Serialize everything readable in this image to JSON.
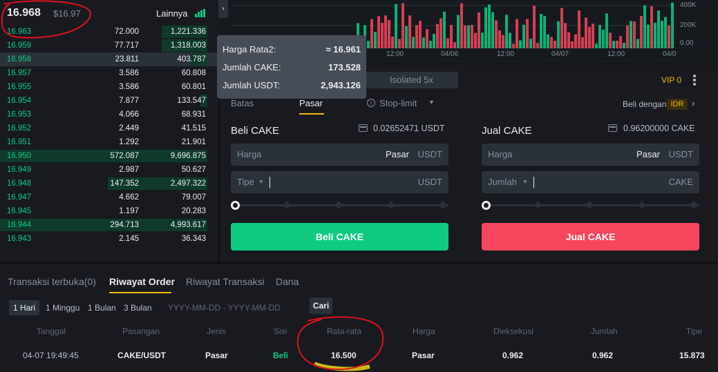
{
  "orderbook": {
    "last_price": "16.968",
    "last_price_usd": "$16.97",
    "more_label": "Lainnya",
    "rows": [
      {
        "price": "16.963",
        "amount": "72.000",
        "total": "1,221.336"
      },
      {
        "price": "16.959",
        "amount": "77.717",
        "total": "1,318.003"
      },
      {
        "price": "16.958",
        "amount": "23.811",
        "total": "403.787"
      },
      {
        "price": "16.957",
        "amount": "3.586",
        "total": "60.808"
      },
      {
        "price": "16.955",
        "amount": "3.586",
        "total": "60.801"
      },
      {
        "price": "16.954",
        "amount": "7.877",
        "total": "133.547"
      },
      {
        "price": "16.953",
        "amount": "4.066",
        "total": "68.931"
      },
      {
        "price": "16.952",
        "amount": "2.449",
        "total": "41.515"
      },
      {
        "price": "16.951",
        "amount": "1.292",
        "total": "21.901"
      },
      {
        "price": "16.950",
        "amount": "572.087",
        "total": "9,696.875"
      },
      {
        "price": "16.949",
        "amount": "2.987",
        "total": "50.627"
      },
      {
        "price": "16.948",
        "amount": "147.352",
        "total": "2,497.322"
      },
      {
        "price": "16.947",
        "amount": "4.662",
        "total": "79.007"
      },
      {
        "price": "16.945",
        "amount": "1.197",
        "total": "20.283"
      },
      {
        "price": "16.944",
        "amount": "294.713",
        "total": "4,993.617"
      },
      {
        "price": "16.943",
        "amount": "2.145",
        "total": "36.343"
      }
    ]
  },
  "chart": {
    "collapse_glyph": "›",
    "time_labels": [
      "12:00",
      "04/06",
      "12:00",
      "04/07",
      "12:00",
      "04/0"
    ],
    "volume_labels": [
      "400K",
      "200K",
      "0.00"
    ]
  },
  "tooltip": {
    "avg_price_label": "Harga Rata2:",
    "avg_price_value": "≈ 16.961",
    "qty_label": "Jumlah CAKE:",
    "qty_value": "173.528",
    "total_label": "Jumlah USDT:",
    "total_value": "2,943.126"
  },
  "trade": {
    "margin_mode": "Isolated 5x",
    "vip": "VIP 0",
    "order_types": [
      "Batas",
      "Pasar",
      "Stop-limit"
    ],
    "buy_with_label": "Beli dengan",
    "buy_with_currency": "IDR",
    "buy": {
      "title": "Beli CAKE",
      "available": "0.02652471 USDT",
      "price_label": "Harga",
      "price_value": "Pasar",
      "price_unit": "USDT",
      "amount_label": "Tipe",
      "amount_unit": "USDT",
      "button": "Beli CAKE"
    },
    "sell": {
      "title": "Jual CAKE",
      "available": "0.96200000 CAKE",
      "price_label": "Harga",
      "price_value": "Pasar",
      "price_unit": "USDT",
      "amount_label": "Jumlah",
      "amount_unit": "CAKE",
      "button": "Jual CAKE"
    }
  },
  "orders": {
    "tabs": [
      "Transaksi terbuka(0)",
      "Riwayat Order",
      "Riwayat Transaksi",
      "Dana"
    ],
    "periods": [
      "1 Hari",
      "1 Minggu",
      "1 Bulan",
      "3 Bulan"
    ],
    "date_placeholder": "YYYY-MM-DD - YYYY-MM-DD",
    "search_label": "Cari",
    "columns": [
      "Tanggal",
      "Pasangan",
      "Jenis",
      "Sisi",
      "Rata-rata",
      "Harga",
      "Dieksekusi",
      "Jumlah",
      "Tipe"
    ],
    "rows": [
      {
        "date": "04-07 19:49:45",
        "pair": "CAKE/USDT",
        "type": "Pasar",
        "side": "Beli",
        "average": "16.500",
        "price": "Pasar",
        "executed": "0.962",
        "amount": "0.962",
        "total": "15.873"
      }
    ]
  },
  "colors": {
    "buy": "#0ecb81",
    "sell": "#f6465d",
    "accent": "#f0b90b",
    "annotation": "#e0101a"
  }
}
